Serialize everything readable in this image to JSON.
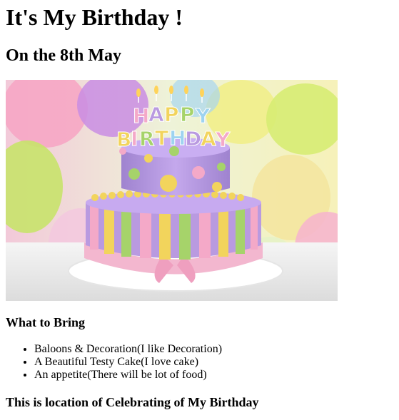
{
  "title": "It's My Birthday !",
  "subtitle": "On the 8th May",
  "cake_image": {
    "topper_line1": "HAPPY",
    "topper_line2": "BIRTHDAY",
    "colors": {
      "lavender": "#b99ae0",
      "pink": "#f4a9c8",
      "yellow": "#f2d45c",
      "green": "#a6d36a",
      "ribbon": "#f3b7cf"
    }
  },
  "bring_heading": "What to Bring",
  "bring_items": [
    "Baloons & Decoration(I like Decoration)",
    "A Beautiful Testy Cake(I love cake)",
    "An appetite(There will be lot of food)"
  ],
  "location_heading": "This is location of Celebrating of My Birthday"
}
